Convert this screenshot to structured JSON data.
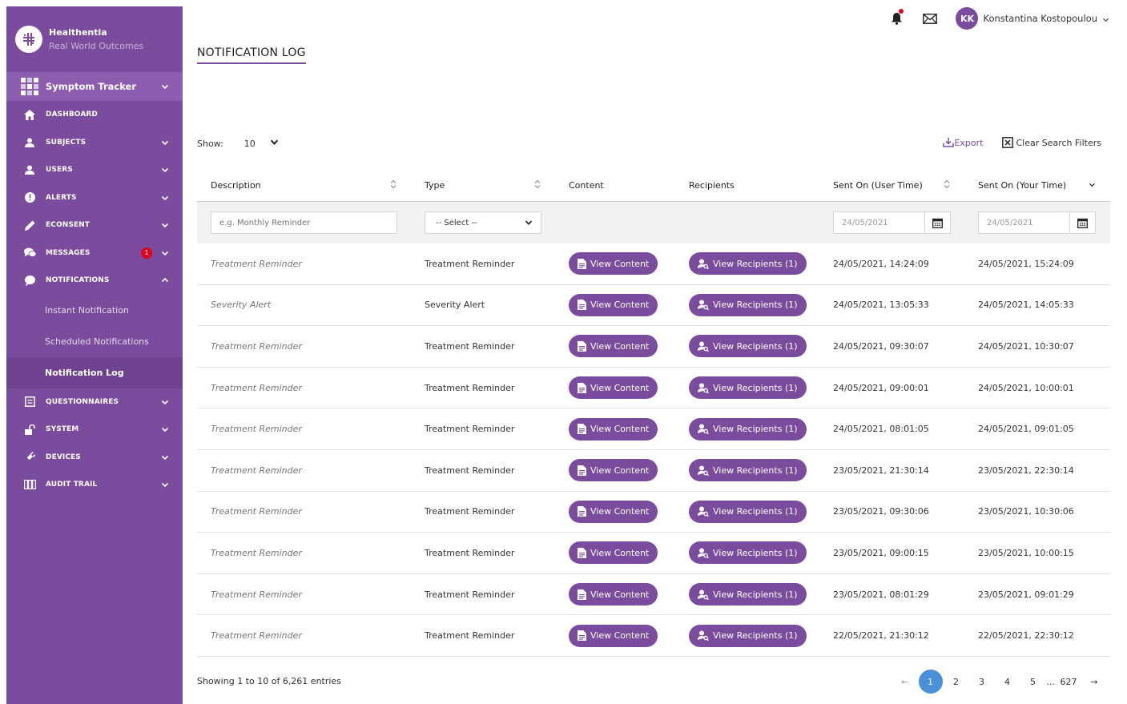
{
  "brand": {
    "name": "Healthentia",
    "tagline": "Real World Outcomes"
  },
  "module": {
    "label": "Symptom Tracker"
  },
  "sidebar": {
    "items": [
      {
        "label": "DASHBOARD"
      },
      {
        "label": "SUBJECTS"
      },
      {
        "label": "USERS"
      },
      {
        "label": "ALERTS"
      },
      {
        "label": "ECONSENT"
      },
      {
        "label": "MESSAGES",
        "badge": "1"
      },
      {
        "label": "NOTIFICATIONS"
      },
      {
        "label": "QUESTIONNAIRES"
      },
      {
        "label": "SYSTEM"
      },
      {
        "label": "DEVICES"
      },
      {
        "label": "AUDIT TRAIL"
      }
    ],
    "notifications_sub": [
      {
        "label": "Instant Notification"
      },
      {
        "label": "Scheduled Notifications"
      },
      {
        "label": "Notification Log"
      }
    ]
  },
  "user": {
    "initials": "KK",
    "name": "Konstantina Kostopoulou"
  },
  "page": {
    "title": "NOTIFICATION LOG"
  },
  "toolbar": {
    "show_label": "Show:",
    "show_value": "10",
    "export_label": "Export",
    "clear_label": "Clear Search Filters"
  },
  "table": {
    "headers": [
      "Description",
      "Type",
      "Content",
      "Recipients",
      "Sent On (User Time)",
      "Sent On (Your Time)"
    ],
    "filters": {
      "description_placeholder": "e.g. Monthly Reminder",
      "type_value": "-- Select --",
      "user_time_value": "24/05/2021",
      "your_time_value": "24/05/2021"
    },
    "content_button": "View Content",
    "recipients_button": "View Recipients (1)",
    "rows": [
      {
        "description": "Treatment Reminder",
        "type": "Treatment Reminder",
        "user_time": "24/05/2021, 14:24:09",
        "your_time": "24/05/2021, 15:24:09"
      },
      {
        "description": "Severity Alert",
        "type": "Severity Alert",
        "user_time": "24/05/2021, 13:05:33",
        "your_time": "24/05/2021, 14:05:33"
      },
      {
        "description": "Treatment Reminder",
        "type": "Treatment Reminder",
        "user_time": "24/05/2021, 09:30:07",
        "your_time": "24/05/2021, 10:30:07"
      },
      {
        "description": "Treatment Reminder",
        "type": "Treatment Reminder",
        "user_time": "24/05/2021, 09:00:01",
        "your_time": "24/05/2021, 10:00:01"
      },
      {
        "description": "Treatment Reminder",
        "type": "Treatment Reminder",
        "user_time": "24/05/2021, 08:01:05",
        "your_time": "24/05/2021, 09:01:05"
      },
      {
        "description": "Treatment Reminder",
        "type": "Treatment Reminder",
        "user_time": "23/05/2021, 21:30:14",
        "your_time": "23/05/2021, 22:30:14"
      },
      {
        "description": "Treatment Reminder",
        "type": "Treatment Reminder",
        "user_time": "23/05/2021, 09:30:06",
        "your_time": "23/05/2021, 10:30:06"
      },
      {
        "description": "Treatment Reminder",
        "type": "Treatment Reminder",
        "user_time": "23/05/2021, 09:00:15",
        "your_time": "23/05/2021, 10:00:15"
      },
      {
        "description": "Treatment Reminder",
        "type": "Treatment Reminder",
        "user_time": "23/05/2021, 08:01:29",
        "your_time": "23/05/2021, 09:01:29"
      },
      {
        "description": "Treatment Reminder",
        "type": "Treatment Reminder",
        "user_time": "22/05/2021, 21:30:12",
        "your_time": "22/05/2021, 22:30:12"
      }
    ]
  },
  "footer": {
    "info": "Showing 1 to 10 of 6,261 entries"
  },
  "pagination": {
    "prev": "←",
    "pages": [
      "1",
      "2",
      "3",
      "4",
      "5"
    ],
    "ellipsis": "...",
    "last": "627",
    "next": "→",
    "current": "1"
  },
  "colors": {
    "primary": "#7b4b9e",
    "module_bg": "#8c5daf",
    "active_sub_bg": "#6f4290",
    "badge": "#e2001a",
    "pager_active": "#4a90d9"
  }
}
